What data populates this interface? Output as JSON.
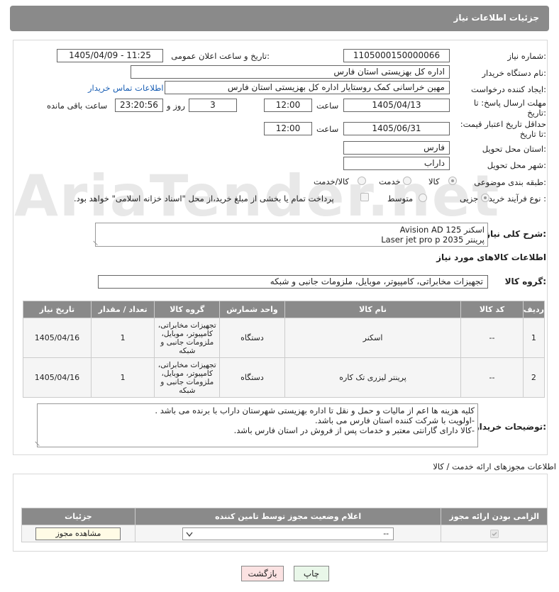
{
  "header": {
    "title": "جزئیات اطلاعات نیاز"
  },
  "fields": {
    "need_number_label": "شماره نیاز:",
    "need_number": "1105000150000066",
    "announce_label": "تاریخ و ساعت اعلان عمومی:",
    "announce_value": "1405/04/09 - 11:25",
    "buyer_org_label": "نام دستگاه خریدار:",
    "buyer_org": "اداره کل بهزیستی استان فارس",
    "creator_label": "ایجاد کننده درخواست:",
    "creator": "مهین خراسانی کمک روستایار اداره کل بهزیستی استان فارس",
    "contact_link": "اطلاعات تماس خریدار",
    "deadline_label": "مهلت ارسال پاسخ: تا تاریخ:",
    "deadline_date": "1405/04/13",
    "time_label": "ساعت",
    "deadline_time": "12:00",
    "days_value": "3",
    "days_label": "روز و",
    "remaining_time": "23:20:56",
    "remaining_label": "ساعت باقی مانده",
    "validity_label": "حداقل تاریخ اعتبار قیمت: تا تاریخ:",
    "validity_date": "1405/06/31",
    "validity_time": "12:00",
    "province_label": "استان محل تحویل:",
    "province": "فارس",
    "city_label": "شهر محل تحویل:",
    "city": "داراب",
    "category_label": "طبقه بندی موضوعی:",
    "category_options": [
      "کالا",
      "خدمت",
      "کالا/خدمت"
    ],
    "process_label": "نوع فرآیند خرید :",
    "process_options": [
      "جزیی",
      "متوسط"
    ],
    "payment_note": "پرداخت تمام یا بخشی از مبلغ خرید،از محل \"اسناد خزانه اسلامی\" خواهد بود."
  },
  "description": {
    "label": "شرح کلی نیاز:",
    "line1": "اسکنر Avision AD 125",
    "line2": "پرینتر Laser jet pro p 2035"
  },
  "goods_info_title": "اطلاعات کالاهای مورد نیاز",
  "goods_group": {
    "label": "گروه کالا:",
    "value": "تجهیزات مخابراتی، کامپیوتر، موبایل، ملزومات جانبی و شبکه"
  },
  "goods_table": {
    "headers": [
      "ردیف",
      "کد کالا",
      "نام کالا",
      "واحد شمارش",
      "گروه کالا",
      "تعداد / مقدار",
      "تاریخ نیاز"
    ],
    "rows": [
      {
        "row": "1",
        "code": "--",
        "name": "اسکنر",
        "unit": "دستگاه",
        "group": "تجهیزات مخابراتی، کامپیوتر، موبایل، ملزومات جانبی و شبکه",
        "qty": "1",
        "date": "1405/04/16"
      },
      {
        "row": "2",
        "code": "--",
        "name": "پرینتر لیزری تک کاره",
        "unit": "دستگاه",
        "group": "تجهیزات مخابراتی، کامپیوتر، موبایل، ملزومات جانبی و شبکه",
        "qty": "1",
        "date": "1405/04/16"
      }
    ]
  },
  "buyer_notes": {
    "label": "توضیحات خریدار:",
    "line1": "کلیه هزینه ها اعم از مالیات و حمل و نقل تا اداره بهزیستی شهرستان داراب با برنده می باشد .",
    "line2": "-اولویت با شرکت کننده استان فارس می باشد.",
    "line3": "-کالا دارای گارانتی معتبر و خدمات پس از فروش در استان فارس باشد."
  },
  "license_section": {
    "title": "اطلاعات مجوزهای ارائه خدمت / کالا",
    "headers": [
      "الزامی بودن ارائه مجوز",
      "اعلام وضعیت مجوز توسط تامین کننده",
      "جزئیات"
    ],
    "select_value": "--",
    "view_button": "مشاهده مجوز"
  },
  "buttons": {
    "print": "چاپ",
    "back": "بازگشت"
  },
  "watermark": "AriaTender.net"
}
